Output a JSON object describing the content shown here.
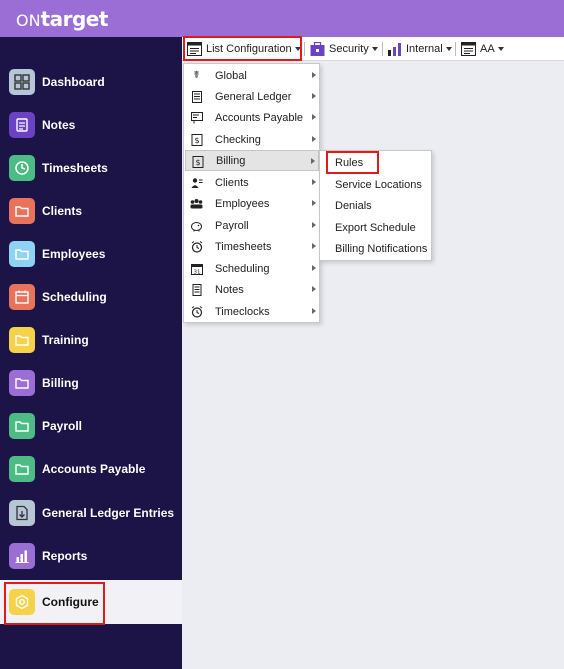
{
  "app": {
    "logo_prefix": "ON",
    "logo_text": "target"
  },
  "colors": {
    "topbar": "#9b6ed6",
    "sidebar": "#1c1346",
    "highlight_box": "#e11b1b"
  },
  "sidebar": {
    "items": [
      {
        "label": "Dashboard",
        "icon": "grid-icon",
        "color": "#b6c6d7"
      },
      {
        "label": "Notes",
        "icon": "notepad-icon",
        "color": "#6b42c4"
      },
      {
        "label": "Timesheets",
        "icon": "clock-icon",
        "color": "#4dbb86"
      },
      {
        "label": "Clients",
        "icon": "folder-icon",
        "color": "#e8735a"
      },
      {
        "label": "Employees",
        "icon": "folder-icon",
        "color": "#8fd3f4"
      },
      {
        "label": "Scheduling",
        "icon": "calendar-icon",
        "color": "#e8735a"
      },
      {
        "label": "Training",
        "icon": "folder-icon",
        "color": "#f5d24a"
      },
      {
        "label": "Billing",
        "icon": "folder-icon",
        "color": "#9b6ed6"
      },
      {
        "label": "Payroll",
        "icon": "folder-icon",
        "color": "#4dbb86"
      },
      {
        "label": "Accounts Payable",
        "icon": "folder-icon",
        "color": "#4dbb86"
      },
      {
        "label": "General Ledger Entries",
        "icon": "download-doc-icon",
        "color": "#b6c6d7"
      },
      {
        "label": "Reports",
        "icon": "bar-chart-icon",
        "color": "#9b6ed6"
      },
      {
        "label": "Configure",
        "icon": "hexagon-gear-icon",
        "color": "#f5d24a",
        "active": true
      }
    ]
  },
  "toolbar": {
    "list_config": "List Configuration",
    "security": "Security",
    "internal": "Internal",
    "aa": "AA"
  },
  "menu": {
    "items": [
      {
        "label": "Global",
        "icon": "caduceus-icon"
      },
      {
        "label": "General Ledger",
        "icon": "ledger-icon"
      },
      {
        "label": "Accounts Payable",
        "icon": "invoice-icon"
      },
      {
        "label": "Checking",
        "icon": "dollar-icon"
      },
      {
        "label": "Billing",
        "icon": "dollar-icon",
        "highlighted": true
      },
      {
        "label": "Clients",
        "icon": "client-list-icon"
      },
      {
        "label": "Employees",
        "icon": "people-icon"
      },
      {
        "label": "Payroll",
        "icon": "piggy-bank-icon"
      },
      {
        "label": "Timesheets",
        "icon": "alarm-clock-icon"
      },
      {
        "label": "Scheduling",
        "icon": "calendar-icon"
      },
      {
        "label": "Notes",
        "icon": "notepad-icon"
      },
      {
        "label": "Timeclocks",
        "icon": "alarm-clock-icon"
      }
    ]
  },
  "submenu": {
    "items": [
      {
        "label": "Rules"
      },
      {
        "label": "Service Locations"
      },
      {
        "label": "Denials"
      },
      {
        "label": "Export Schedule"
      },
      {
        "label": "Billing Notifications"
      }
    ]
  }
}
